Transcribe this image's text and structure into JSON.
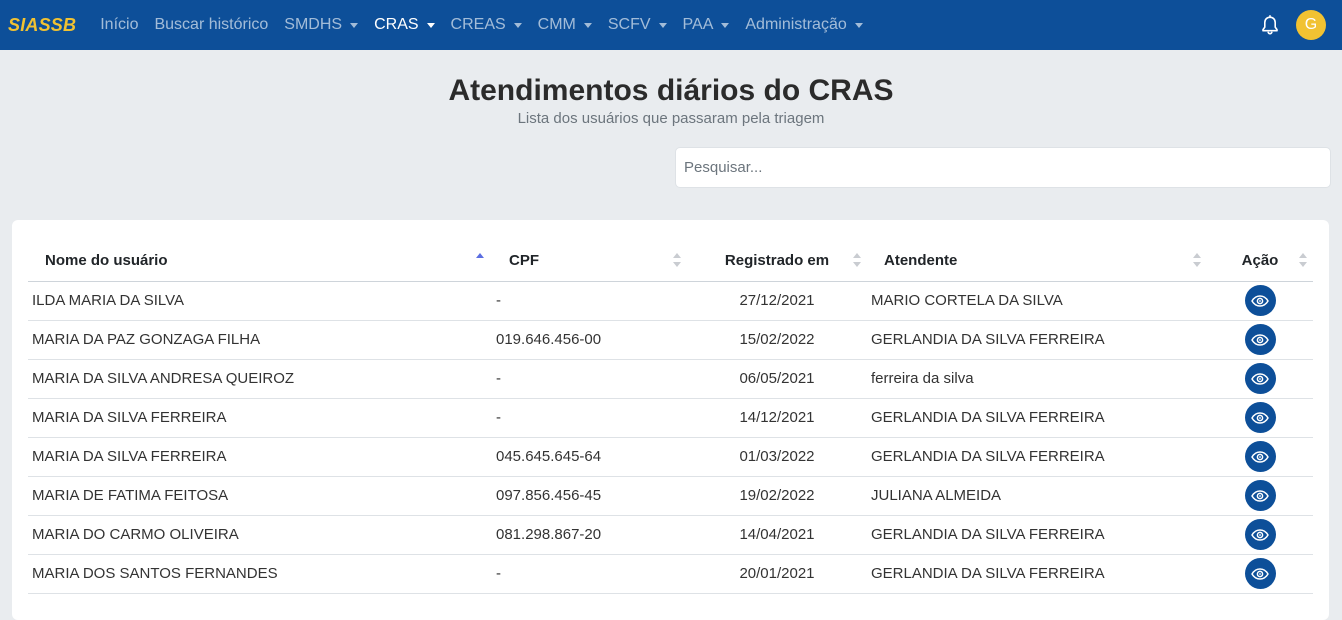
{
  "navbar": {
    "brand": "SIASSB",
    "items": [
      {
        "label": "Início",
        "dropdown": false,
        "active": false
      },
      {
        "label": "Buscar histórico",
        "dropdown": false,
        "active": false
      },
      {
        "label": "SMDHS",
        "dropdown": true,
        "active": false
      },
      {
        "label": "CRAS",
        "dropdown": true,
        "active": true
      },
      {
        "label": "CREAS",
        "dropdown": true,
        "active": false
      },
      {
        "label": "CMM",
        "dropdown": true,
        "active": false
      },
      {
        "label": "SCFV",
        "dropdown": true,
        "active": false
      },
      {
        "label": "PAA",
        "dropdown": true,
        "active": false
      },
      {
        "label": "Administração",
        "dropdown": true,
        "active": false
      }
    ],
    "bell_icon": "bell-icon",
    "avatar_initial": "G"
  },
  "header": {
    "title": "Atendimentos diários do CRAS",
    "subtitle": "Lista dos usuários que passaram pela triagem"
  },
  "search": {
    "placeholder": "Pesquisar...",
    "value": ""
  },
  "table": {
    "columns": [
      {
        "label": "Nome do usuário",
        "sort": "asc"
      },
      {
        "label": "CPF",
        "sort": "none"
      },
      {
        "label": "Registrado em",
        "sort": "none"
      },
      {
        "label": "Atendente",
        "sort": "none"
      },
      {
        "label": "Ação",
        "sort": "none"
      }
    ],
    "rows": [
      {
        "nome": "ILDA MARIA DA SILVA",
        "cpf": "-",
        "registrado": "27/12/2021",
        "atendente": "MARIO CORTELA DA SILVA",
        "acao_icon": "eye-icon"
      },
      {
        "nome": "MARIA DA PAZ GONZAGA FILHA",
        "cpf": "019.646.456-00",
        "registrado": "15/02/2022",
        "atendente": "GERLANDIA DA SILVA FERREIRA",
        "acao_icon": "eye-icon"
      },
      {
        "nome": "MARIA DA SILVA ANDRESA QUEIROZ",
        "cpf": "-",
        "registrado": "06/05/2021",
        "atendente": "ferreira da silva",
        "acao_icon": "eye-icon"
      },
      {
        "nome": "MARIA DA SILVA FERREIRA",
        "cpf": "-",
        "registrado": "14/12/2021",
        "atendente": "GERLANDIA DA SILVA FERREIRA",
        "acao_icon": "eye-icon"
      },
      {
        "nome": "MARIA DA SILVA FERREIRA",
        "cpf": "045.645.645-64",
        "registrado": "01/03/2022",
        "atendente": "GERLANDIA DA SILVA FERREIRA",
        "acao_icon": "eye-icon"
      },
      {
        "nome": "MARIA DE FATIMA FEITOSA",
        "cpf": "097.856.456-45",
        "registrado": "19/02/2022",
        "atendente": "JULIANA ALMEIDA",
        "acao_icon": "eye-icon"
      },
      {
        "nome": "MARIA DO CARMO OLIVEIRA",
        "cpf": "081.298.867-20",
        "registrado": "14/04/2021",
        "atendente": "GERLANDIA DA SILVA FERREIRA",
        "acao_icon": "eye-icon"
      },
      {
        "nome": "MARIA DOS SANTOS FERNANDES",
        "cpf": "-",
        "registrado": "20/01/2021",
        "atendente": "GERLANDIA DA SILVA FERREIRA",
        "acao_icon": "eye-icon"
      }
    ]
  },
  "colors": {
    "navbar_bg": "#0d4f99",
    "brand": "#f1c232",
    "page_bg": "#e9ecef",
    "action_button": "#0d4f99",
    "sort_active": "#5b6ee1"
  }
}
